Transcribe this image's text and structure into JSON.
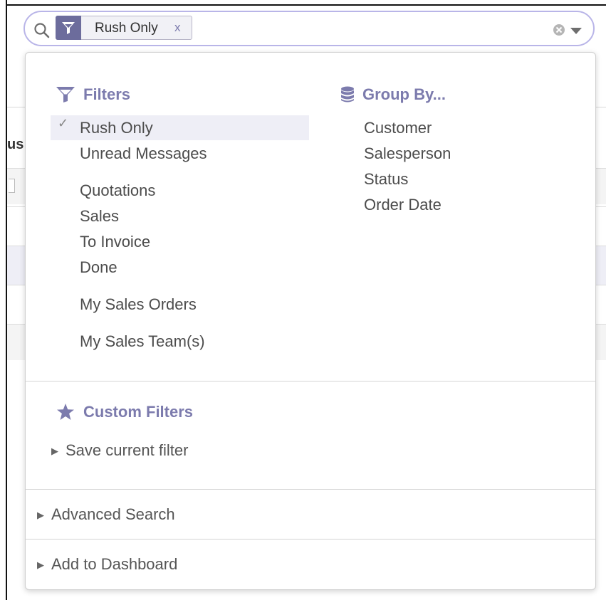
{
  "background": {
    "column_fragment": "us"
  },
  "search": {
    "facet_value": "Rush Only",
    "facet_remove": "x"
  },
  "filters": {
    "heading": "Filters",
    "items": [
      "Rush Only",
      "Unread Messages",
      "Quotations",
      "Sales",
      "To Invoice",
      "Done",
      "My Sales Orders",
      "My Sales Team(s)"
    ],
    "selected": "Rush Only"
  },
  "group_by": {
    "heading": "Group By...",
    "items": [
      "Customer",
      "Salesperson",
      "Status",
      "Order Date"
    ]
  },
  "custom_filters": {
    "heading": "Custom Filters",
    "save_label": "Save current filter"
  },
  "advanced_search": {
    "label": "Advanced Search"
  },
  "dashboard": {
    "label": "Add to Dashboard"
  },
  "colors": {
    "accent": "#7c7bad",
    "facet_icon_bg": "#6c6c9c",
    "selected_bg": "#eeeef6",
    "search_border": "#b9b5e8"
  },
  "icons": {
    "search": "magnifier",
    "facet": "funnel",
    "clear": "x-circle",
    "dropdown": "caret-down",
    "filters": "funnel",
    "group_by": "database",
    "custom_filters": "star"
  }
}
